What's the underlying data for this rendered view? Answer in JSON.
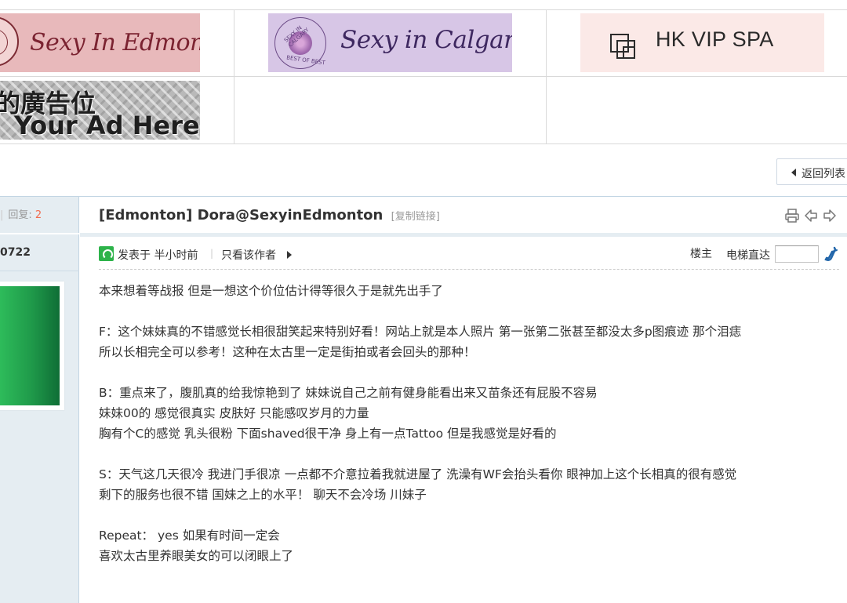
{
  "ads": {
    "edmonton": "Sexy In Edmonton",
    "calgary": "Sexy in Calgary",
    "calgary_seal_top": "SEXY IN CALGARY",
    "calgary_seal_bottom": "BEST OF BEST",
    "hk": "HK VIP SPA",
    "your_ad_cn": "的廣告位",
    "your_ad_en": "Your Ad Here"
  },
  "nav": {
    "back_label": "返回列表"
  },
  "sidebar": {
    "replies_label": "回复:",
    "replies_count": "2",
    "user_id": "0722"
  },
  "post": {
    "title": "[Edmonton] Dora@SexyinEdmonton",
    "copy_link": "[复制链接]",
    "icons": [
      "print-icon",
      "prev-thread-icon",
      "next-thread-icon"
    ],
    "posted": "发表于 半小时前",
    "author_only": "只看该作者",
    "floor": "楼主",
    "jump_label": "电梯直达",
    "jump_value": "",
    "lines": [
      "本来想着等战报 但是一想这个价位估计得等很久于是就先出手了",
      "",
      "F：这个妹妹真的不错感觉长相很甜笑起来特别好看！网站上就是本人照片 第一张第二张甚至都没太多p图痕迹 那个泪痣",
      "所以长相完全可以参考！这种在太古里一定是街拍或者会回头的那种！",
      "",
      "B：重点来了，腹肌真的给我惊艳到了 妹妹说自己之前有健身能看出来又苗条还有屁股不容易",
      "妹妹00的 感觉很真实 皮肤好 只能感叹岁月的力量",
      "胸有个C的感觉 乳头很粉 下面shaved很干净 身上有一点Tattoo 但是我感觉是好看的",
      "",
      "S：天气这几天很冷 我进门手很凉 一点都不介意拉着我就进屋了 洗澡有WF会抬头看你 眼神加上这个长相真的很有感觉",
      "剩下的服务也很不错 国妹之上的水平！ 聊天不会冷场 川妹子",
      "",
      "Repeat： yes 如果有时间一定会",
      "喜欢太古里养眼美女的可以闭眼上了"
    ]
  },
  "colors": {
    "accent_red": "#f26c4f",
    "link_blue": "#336699",
    "sidebar_bg": "#e5edf2"
  }
}
